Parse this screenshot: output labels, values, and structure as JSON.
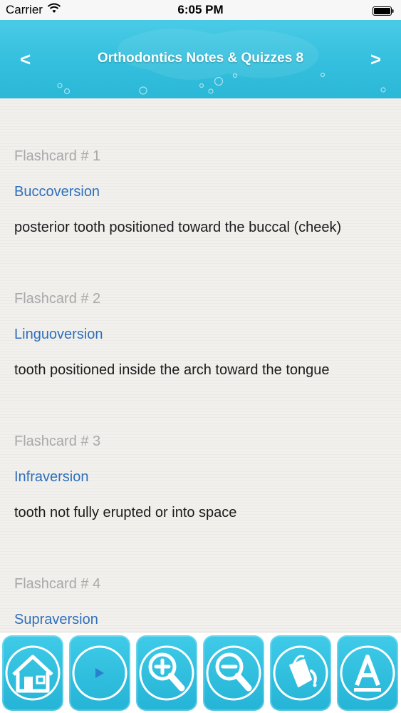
{
  "status_bar": {
    "carrier": "Carrier",
    "time": "6:05 PM"
  },
  "header": {
    "title": "Orthodontics Notes & Quizzes 8",
    "prev_label": "<",
    "next_label": ">"
  },
  "flashcards": [
    {
      "number": "Flashcard # 1",
      "term": "Buccoversion",
      "definition": "posterior tooth positioned toward the buccal (cheek)"
    },
    {
      "number": "Flashcard # 2",
      "term": "Linguoversion",
      "definition": "tooth positioned inside the arch toward the tongue"
    },
    {
      "number": "Flashcard # 3",
      "term": "Infraversion",
      "definition": "tooth not fully erupted or into space"
    },
    {
      "number": "Flashcard # 4",
      "term": "Supraversion",
      "definition": ""
    }
  ],
  "toolbar": {
    "buttons": [
      "home-icon",
      "play-icon",
      "zoom-in-icon",
      "zoom-out-icon",
      "paint-bucket-icon",
      "font-icon"
    ]
  },
  "colors": {
    "header": "#33bfdd",
    "term": "#2f6fba",
    "card_number": "#a8a8a8",
    "toolbar_button": "#25b4d6"
  }
}
